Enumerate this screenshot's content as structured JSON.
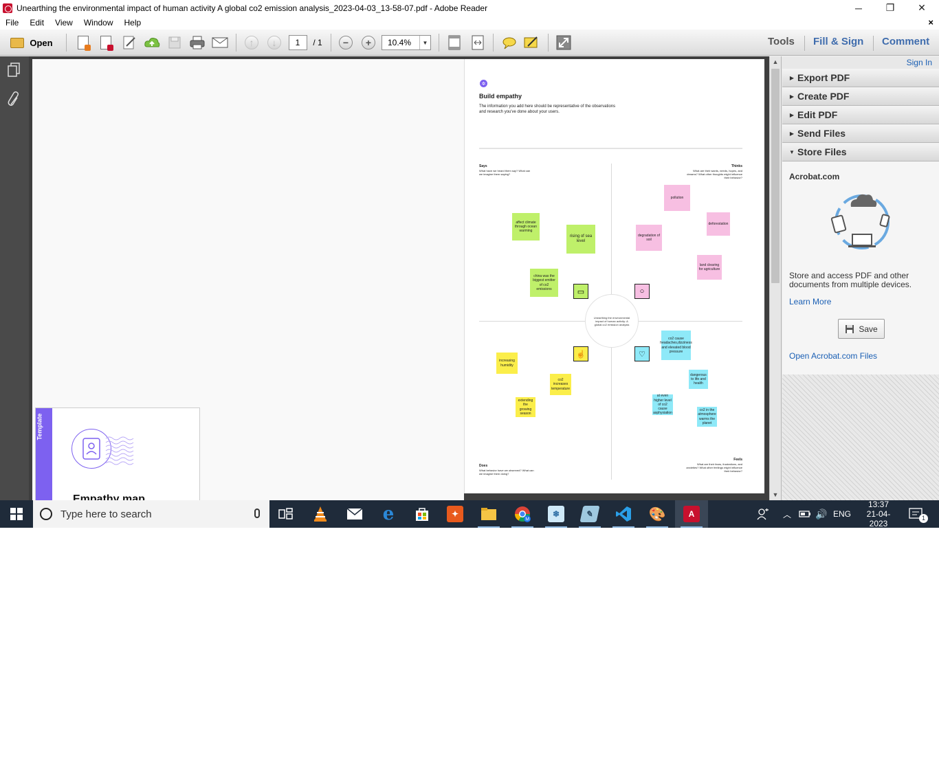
{
  "window": {
    "title": "Unearthing the environmental impact of human activity  A global co2 emission analysis_2023-04-03_13-58-07.pdf - Adobe Reader",
    "minimize": "─",
    "restore": "❐",
    "close": "✕"
  },
  "menu": {
    "items": [
      "File",
      "Edit",
      "View",
      "Window",
      "Help"
    ],
    "close": "×"
  },
  "toolbar": {
    "open_label": "Open",
    "page_current": "1",
    "page_total": "/ 1",
    "zoom": "10.4%",
    "tabs": [
      "Tools",
      "Fill & Sign",
      "Comment"
    ]
  },
  "document": {
    "page_title": "Build empathy",
    "page_intro": "The information you add here should be representative of the observations and research you've done about your users.",
    "quadrants": {
      "says": {
        "title": "Says",
        "desc": "What have we heard them say? What can we imagine them saying?"
      },
      "thinks": {
        "title": "Thinks",
        "desc": "What are their wants, needs, hopes, and dreams? What other thoughts might influence their behavior?"
      },
      "does": {
        "title": "Does",
        "desc": "What behavior have we observed? What can we imagine them doing?"
      },
      "feels": {
        "title": "Feels",
        "desc": "What are their fears, frustrations, and anxieties? What other feelings might influence their behavior?"
      }
    },
    "center_text": "Unearthing the environmental impact of human activity: A global co2 emission analysis",
    "notes": {
      "says": [
        "affect climate through ocean warming",
        "rising of sea level",
        "china was the biggest emitter of co2 emissions"
      ],
      "thinks": [
        "pollution",
        "deforestation",
        "degradation of soil",
        "land clearing for agriculture"
      ],
      "does": [
        "increasing humidity",
        "co2 increases temperature",
        "extending the growing season"
      ],
      "feels": [
        "co2 cause headaches,dizziness and elevated blood pressure",
        "dangerous to life and health",
        "at even higher level of co2 cause asphyxiation",
        "co2 in the atmosphere warms the planet"
      ]
    },
    "template": {
      "strip_label": "Template",
      "title": "Empathy map"
    }
  },
  "right_panel": {
    "sign_in": "Sign In",
    "sections": [
      "Export PDF",
      "Create PDF",
      "Edit PDF",
      "Send Files",
      "Store Files"
    ],
    "store": {
      "heading": "Acrobat.com",
      "description": "Store and access PDF and other documents from multiple devices.",
      "learn_more": "Learn More",
      "save_button": "Save",
      "open_link": "Open Acrobat.com Files"
    }
  },
  "taskbar": {
    "search_placeholder": "Type here to search",
    "language": "ENG",
    "time": "13:37",
    "date": "21-04-2023",
    "notification_count": "1"
  },
  "colors": {
    "sticky_green": "#bff06a",
    "sticky_pink": "#f7bfe2",
    "sticky_yellow": "#fbee4a",
    "sticky_blue": "#8ee9f8",
    "accent_purple": "#7d61f0",
    "link_blue": "#1a5fb4"
  }
}
